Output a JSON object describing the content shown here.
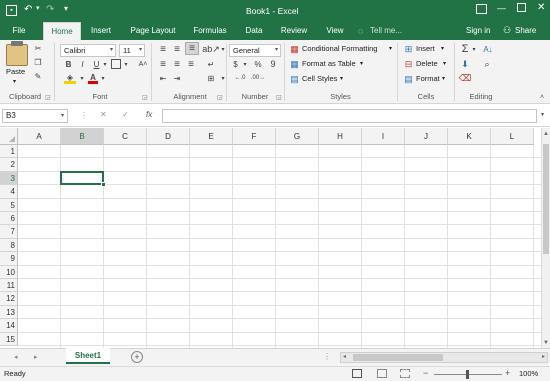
{
  "window": {
    "title": "Book1 - Excel",
    "accent": "#217346"
  },
  "qat": {
    "save_icon": "save-icon",
    "undo_icon": "undo-icon",
    "redo_icon": "redo-icon",
    "customize_icon": "chevron-down-icon"
  },
  "tabs": [
    "File",
    "Home",
    "Insert",
    "Page Layout",
    "Formulas",
    "Data",
    "Review",
    "View"
  ],
  "tell_me": "Tell me...",
  "account": {
    "signin": "Sign in",
    "share": "Share"
  },
  "ribbon": {
    "clipboard": {
      "label": "Clipboard",
      "paste": "Paste"
    },
    "font": {
      "label": "Font",
      "font_name": "Calibri",
      "font_size": "11",
      "bold": "B",
      "italic": "I",
      "underline": "U",
      "font_color": "A"
    },
    "alignment": {
      "label": "Alignment"
    },
    "number": {
      "label": "Number",
      "format": "General",
      "currency": "$",
      "percent": "%",
      "comma": "9"
    },
    "styles": {
      "label": "Styles",
      "conditional": "Conditional Formatting",
      "format_table": "Format as Table",
      "cell_styles": "Cell Styles"
    },
    "cells": {
      "label": "Cells",
      "insert": "Insert",
      "delete": "Delete",
      "format": "Format"
    },
    "editing": {
      "label": "Editing",
      "sum": "Σ"
    }
  },
  "formula_bar": {
    "name_box": "B3",
    "cancel": "✕",
    "enter": "✓",
    "fx": "fx",
    "value": ""
  },
  "grid": {
    "columns": [
      "A",
      "B",
      "C",
      "D",
      "E",
      "F",
      "G",
      "H",
      "I",
      "J",
      "K",
      "L"
    ],
    "rows": [
      "1",
      "2",
      "3",
      "4",
      "5",
      "6",
      "7",
      "8",
      "9",
      "10",
      "11",
      "12",
      "13",
      "14",
      "15"
    ],
    "active_cell": "B3"
  },
  "sheets": {
    "tabs": [
      "Sheet1"
    ],
    "active": "Sheet1",
    "add": "+"
  },
  "status": {
    "ready": "Ready",
    "zoom": "100%",
    "minus": "−",
    "plus": "+"
  }
}
